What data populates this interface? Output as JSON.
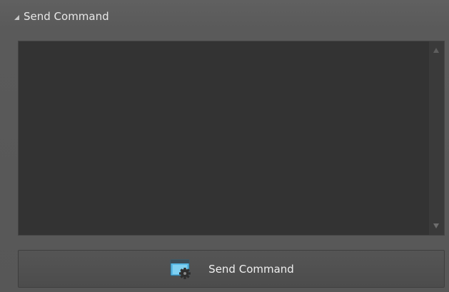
{
  "panel": {
    "header": {
      "title": "Send Command"
    },
    "editor": {
      "value": "",
      "placeholder": ""
    },
    "send_button": {
      "label": "Send Command",
      "icon": "window-gear-icon"
    }
  }
}
